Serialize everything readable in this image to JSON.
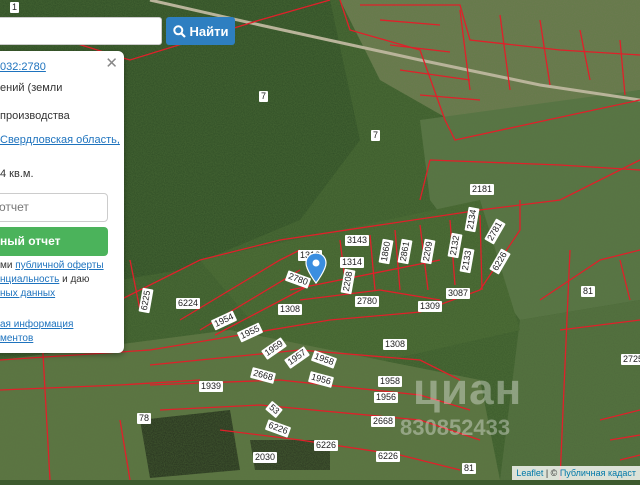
{
  "search": {
    "button_label": "Найти",
    "value": ""
  },
  "popup": {
    "cadastral_number": "032:2780",
    "category_line": "ений (земли",
    "use_line": "производства",
    "address_link": "Свердловская область,",
    "area": "4 кв.м.",
    "report_placeholder": "отчет",
    "report_button": "ный отчет",
    "consent_line1_text": "ми ",
    "consent_line1_link": "публичной оферты",
    "consent_line2_link": "нциальность",
    "consent_line2_text": " и даю",
    "consent_line3_link": "ных данных",
    "info_link1": "ая информация",
    "info_link2": "ментов"
  },
  "plot_labels": [
    "7",
    "7",
    "2181",
    "3143",
    "1310",
    "1314",
    "1860",
    "2861",
    "2209",
    "2132",
    "2134",
    "2781",
    "2133",
    "6226",
    "2780",
    "2208",
    "2780",
    "1309",
    "3087",
    "1308",
    "1308",
    "6224",
    "6225",
    "81",
    "1954",
    "1955",
    "1959",
    "1957",
    "1958",
    "2668",
    "1956",
    "1958",
    "1956",
    "1939",
    "78",
    "53",
    "6226",
    "2668",
    "6226",
    "6226",
    "2030",
    "81",
    "2725",
    "1"
  ],
  "watermark": {
    "brand": "циан",
    "id": "830852433"
  },
  "attribution": {
    "leaflet": "Leaflet",
    "separator": " | © ",
    "source": "Публичная кадаст"
  },
  "colors": {
    "parcel_border": "#e0202a",
    "search_button": "#2e7fc1",
    "report_button": "#4bb35b",
    "marker": "#3b8ee0"
  }
}
